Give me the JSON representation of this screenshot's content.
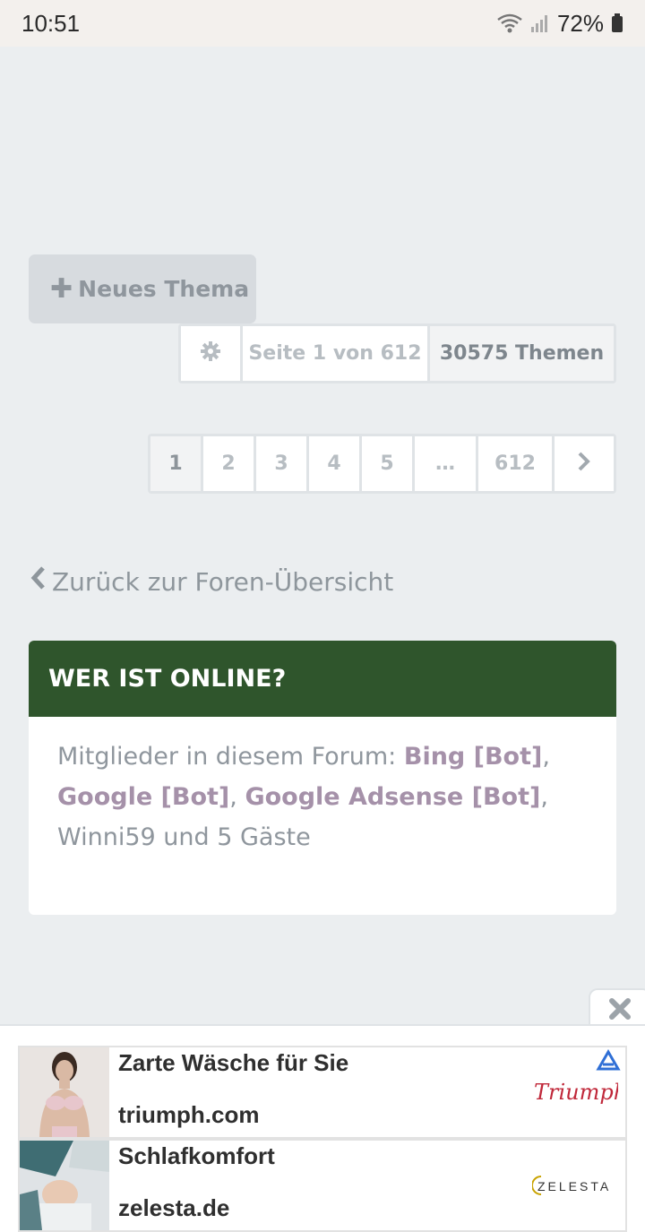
{
  "status_bar": {
    "time": "10:51",
    "battery": "72%",
    "icons": [
      "wifi-icon",
      "signal-icon",
      "battery-icon"
    ]
  },
  "toolbar": {
    "new_topic_label": "Neues Thema",
    "page_label": "Seite 1 von 612",
    "topic_count": "30575 Themen"
  },
  "pagination": {
    "pages": [
      "1",
      "2",
      "3",
      "4",
      "5"
    ],
    "ellipsis": "…",
    "last": "612",
    "active": "1"
  },
  "back_link": "Zurück zur Foren-Übersicht",
  "online": {
    "heading": "WER IST ONLINE?",
    "prefix": "Mitglieder in diesem Forum: ",
    "bot1": "Bing [Bot]",
    "bot2": "Google [Bot]",
    "bot3": "Google Adsense [Bot]",
    "sep": ", ",
    "user": "Winni59",
    "suffix": " und 5 Gäste"
  },
  "ads": [
    {
      "title": "Zarte Wäsche für Sie",
      "domain": "triumph.com",
      "logo_text": "Triumph"
    },
    {
      "title": "Schlafkomfort",
      "domain": "zelesta.de",
      "logo_text": "ZELESTA"
    }
  ],
  "colors": {
    "header_green": "#2f552c",
    "bot_link": "#a591a9",
    "background": "#ebeef0"
  }
}
